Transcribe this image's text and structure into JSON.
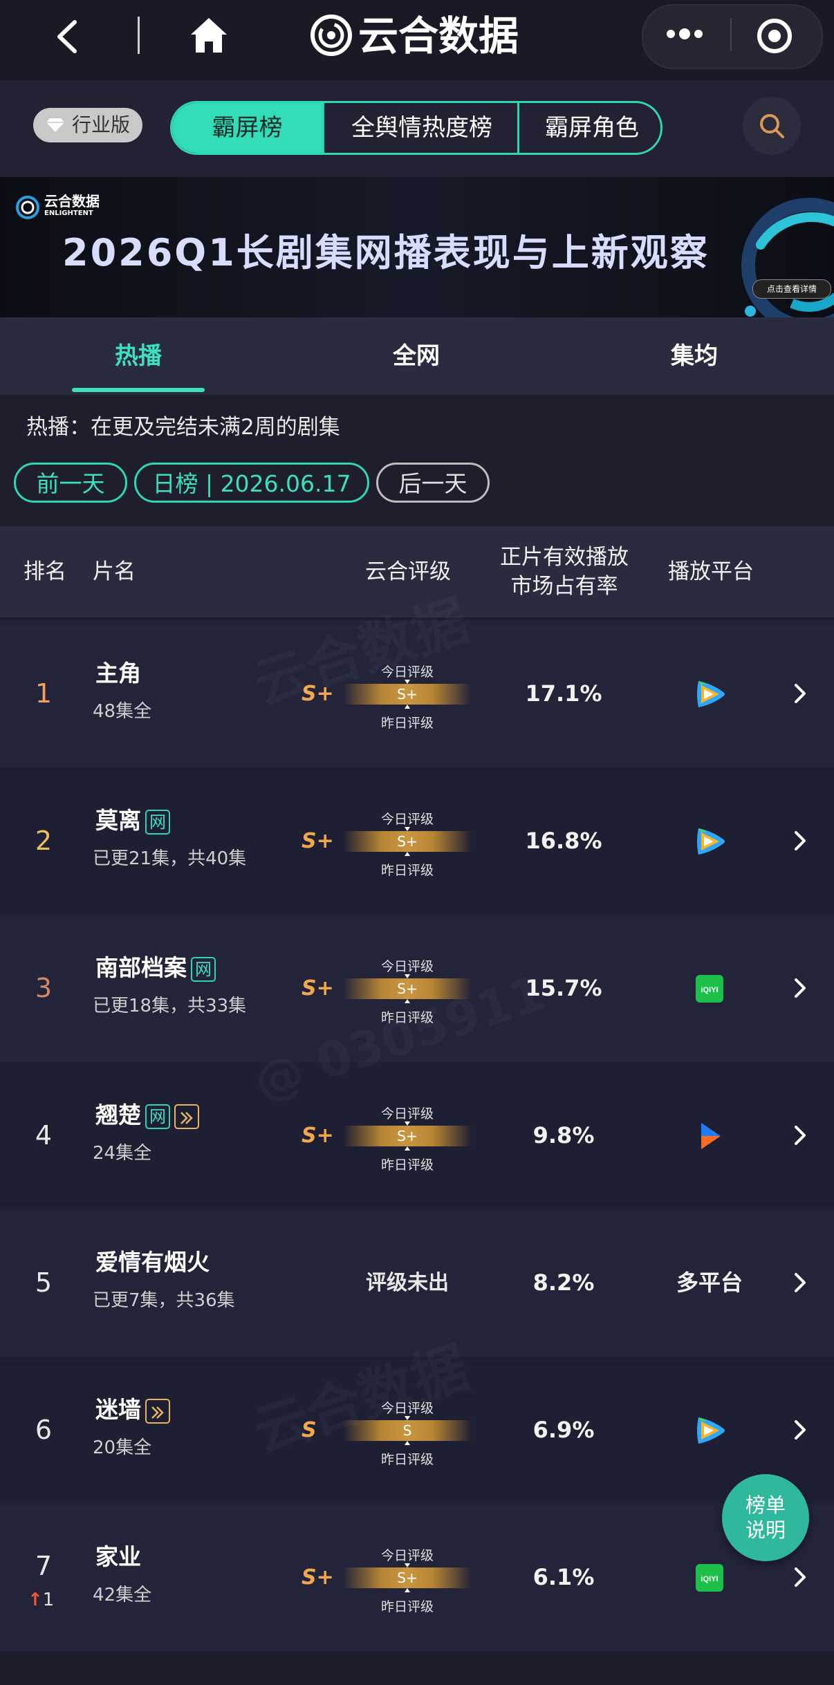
{
  "topbar": {
    "title": "云合数据"
  },
  "category": {
    "badge": "行业版",
    "tabs": [
      "霸屏榜",
      "全舆情热度榜",
      "霸屏角色"
    ]
  },
  "banner": {
    "logo_cn": "云合数据",
    "logo_en": "ENLIGHTENT",
    "title": "2026Q1长剧集网播表现与上新观察",
    "button": "点击查看详情"
  },
  "subtabs": [
    "热播",
    "全网",
    "集均"
  ],
  "info": {
    "description": "热播：在更及完结未满2周的剧集",
    "prev_day": "前一天",
    "date_label": "日榜 | 2026.06.17",
    "next_day": "后一天"
  },
  "table": {
    "headers": {
      "rank": "排名",
      "name": "片名",
      "rating": "云合评级",
      "share_line1": "正片有效播放",
      "share_line2": "市场占有率",
      "platform": "播放平台"
    },
    "gauge_top": "今日评级",
    "gauge_bottom": "昨日评级",
    "rows": [
      {
        "rank": "1",
        "name": "主角",
        "sub": "48集全",
        "grade": "S+",
        "share": "17.1%",
        "platform": "tencent-video",
        "rank_color": "#f0a060"
      },
      {
        "rank": "2",
        "name": "莫离",
        "sub": "已更21集，共40集",
        "grade": "S+",
        "share": "16.8%",
        "platform": "tencent-video",
        "tag": "网",
        "rank_color": "#f0c060"
      },
      {
        "rank": "3",
        "name": "南部档案",
        "sub": "已更18集，共33集",
        "grade": "S+",
        "share": "15.7%",
        "platform": "iqiyi",
        "tag": "网",
        "rank_color": "#d08a6a"
      },
      {
        "rank": "4",
        "name": "翘楚",
        "sub": "24集全",
        "grade": "S+",
        "share": "9.8%",
        "platform": "youku",
        "tag": "网",
        "rank_color": "#e8e8e8"
      },
      {
        "rank": "5",
        "name": "爱情有烟火",
        "sub": "已更7集，共36集",
        "rating_text": "评级未出",
        "share": "8.2%",
        "platform_text": "多平台",
        "rank_color": "#e8e8e8"
      },
      {
        "rank": "6",
        "name": "迷墙",
        "sub": "20集全",
        "grade": "S",
        "share": "6.9%",
        "platform": "tencent-video",
        "rank_color": "#e8e8e8"
      },
      {
        "rank": "7",
        "name": "家业",
        "sub": "42集全",
        "grade": "S+",
        "share": "6.1%",
        "platform": "iqiyi",
        "rank_change": "1",
        "rank_color": "#e8e8e8"
      }
    ]
  },
  "fab": {
    "line1": "榜单",
    "line2": "说明"
  },
  "watermark": "@ 0305911"
}
